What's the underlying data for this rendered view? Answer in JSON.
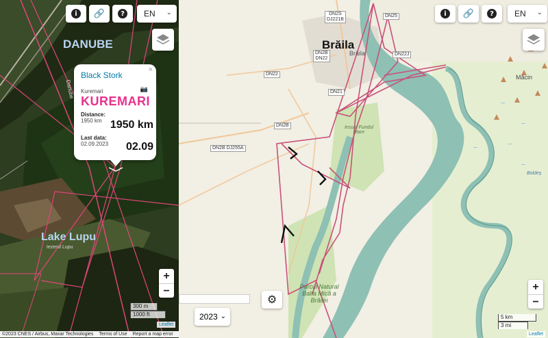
{
  "left_map": {
    "lang": "EN",
    "place_danube": "DANUBE",
    "place_danube_small": "Danube",
    "place_lake": "Lake Lupu",
    "place_lake_small": "Iezerul Lupu",
    "scale_m": "300 m",
    "scale_ft": "1000 ft",
    "leaflet": "Leaflet",
    "attribution": "©2023 CNES / Airbus, Maxar Technologies",
    "terms": "Terms of Use",
    "report": "Report a map error",
    "zoom_in": "+",
    "zoom_out": "−"
  },
  "popup": {
    "bird": "Black Stork",
    "name_small": "Kuremari",
    "name_big": "KUREMARI",
    "distance_label": "Distance:",
    "distance_small": "1950 km",
    "distance_big": "1950 km",
    "last_label": "Last data:",
    "last_small": "02.09.2023",
    "last_big": "02.09",
    "close": "×"
  },
  "right_map": {
    "lang": "EN",
    "city": "Brăila",
    "city_small": "Brăila",
    "town_macin": "Măcin",
    "place_insula": "Insula Fundul Mare",
    "place_park": "Parcul Natural Balta Mică a Brăilei",
    "place_boldesti": "Boldeș",
    "roads": [
      "DN2S",
      "DJ221B",
      "DN25",
      "DN2B",
      "DN22",
      "DN22J",
      "DN22",
      "DN21",
      "DN2B",
      "DN2B DJ255A"
    ],
    "year": "2023",
    "scale_km": "5 km",
    "scale_mi": "3 mi",
    "leaflet": "Leaflet",
    "zoom_in": "+",
    "zoom_out": "−"
  },
  "colors": {
    "track": "#c8507a",
    "river": "#6aaea0",
    "link": "#0078a8",
    "popup_name": "#e8318c"
  }
}
